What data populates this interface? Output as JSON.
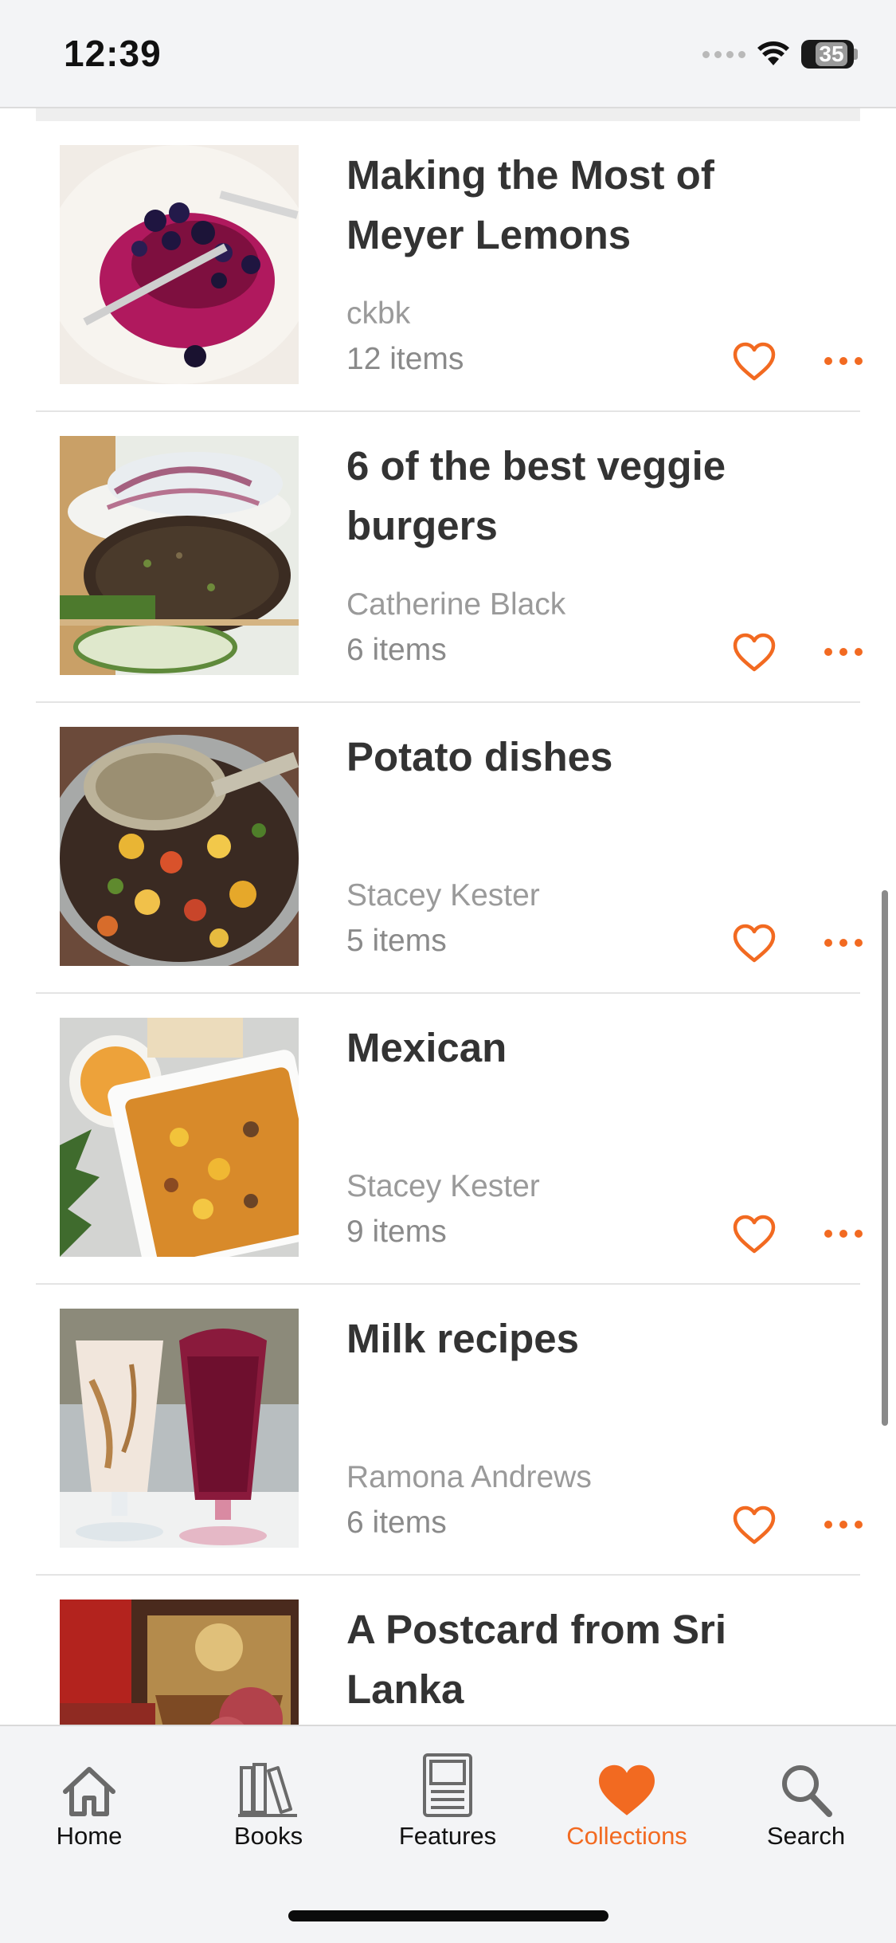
{
  "status_bar": {
    "time": "12:39",
    "battery": "35"
  },
  "collections": [
    {
      "title": "Making the Most of Meyer Lemons",
      "author": "ckbk",
      "count": "12 items"
    },
    {
      "title": "6 of the best veggie burgers",
      "author": "Catherine Black",
      "count": "6 items"
    },
    {
      "title": "Potato dishes",
      "author": "Stacey Kester",
      "count": "5 items"
    },
    {
      "title": "Mexican",
      "author": "Stacey Kester",
      "count": "9 items"
    },
    {
      "title": "Milk recipes",
      "author": "Ramona Andrews",
      "count": "6 items"
    },
    {
      "title": "A Postcard from Sri Lanka",
      "author": "",
      "count": ""
    }
  ],
  "tabs": [
    {
      "label": "Home",
      "icon": "home-icon",
      "active": false
    },
    {
      "label": "Books",
      "icon": "books-icon",
      "active": false
    },
    {
      "label": "Features",
      "icon": "features-icon",
      "active": false
    },
    {
      "label": "Collections",
      "icon": "heart-filled-icon",
      "active": true
    },
    {
      "label": "Search",
      "icon": "search-icon",
      "active": false
    }
  ],
  "colors": {
    "accent": "#f26a21",
    "tabbar_bg": "#f3f4f6",
    "text": "#333333",
    "muted": "#9a9a9a"
  }
}
